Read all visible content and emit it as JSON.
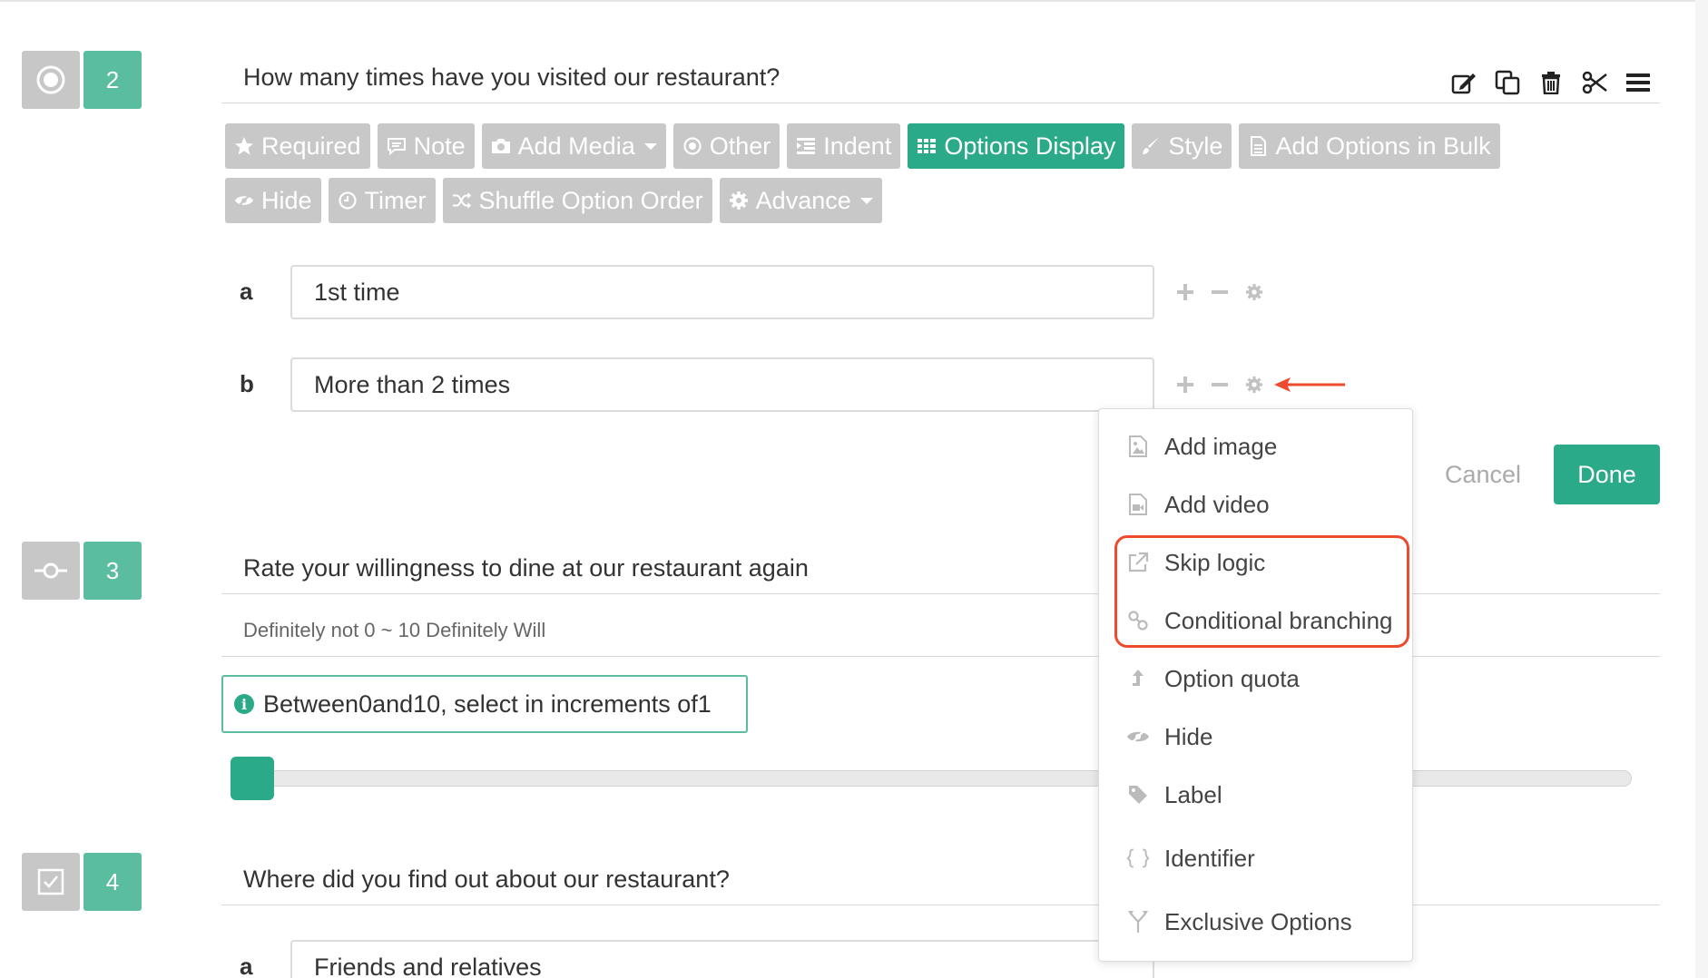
{
  "questions": [
    {
      "number": "2",
      "type_icon": "radio-icon",
      "title": "How many times have you visited our restaurant?",
      "actions": [
        "edit-icon",
        "copy-icon",
        "trash-icon",
        "scissors-icon",
        "menu-icon"
      ],
      "toolbar": {
        "row1": [
          {
            "label": "Required",
            "icon": "star-icon"
          },
          {
            "label": "Note",
            "icon": "comment-icon"
          },
          {
            "label": "Add Media",
            "icon": "camera-icon",
            "caret": true
          },
          {
            "label": "Other",
            "icon": "radio-dot-icon"
          },
          {
            "label": "Indent",
            "icon": "indent-icon"
          },
          {
            "label": "Options Display",
            "icon": "grid-icon",
            "active": true
          },
          {
            "label": "Style",
            "icon": "brush-icon"
          },
          {
            "label": "Add Options in Bulk",
            "icon": "document-icon"
          }
        ],
        "row2": [
          {
            "label": "Hide",
            "icon": "eye-slash-icon"
          },
          {
            "label": "Timer",
            "icon": "clock-icon"
          },
          {
            "label": "Shuffle Option Order",
            "icon": "shuffle-icon"
          },
          {
            "label": "Advance",
            "icon": "gear-icon",
            "caret": true
          }
        ]
      },
      "options": [
        {
          "letter": "a",
          "value": "1st time"
        },
        {
          "letter": "b",
          "value": "More than 2 times"
        }
      ],
      "cancel_label": "Cancel",
      "done_label": "Done"
    },
    {
      "number": "3",
      "type_icon": "slider-type-icon",
      "title": "Rate your willingness to dine at our restaurant again",
      "scale_label": "Definitely not 0 ~ 10 Definitely Will",
      "hint": "Between0and10, select in increments of1",
      "slider_value": 0
    },
    {
      "number": "4",
      "type_icon": "checkbox-icon",
      "title": "Where did you find out about our restaurant?",
      "options": [
        {
          "letter": "a",
          "value": "Friends and relatives"
        }
      ]
    }
  ],
  "option_menu": {
    "items": [
      {
        "label": "Add image",
        "icon": "image-icon"
      },
      {
        "label": "Add video",
        "icon": "video-icon"
      },
      {
        "label": "Skip logic",
        "icon": "external-link-icon"
      },
      {
        "label": "Conditional branching",
        "icon": "link-icon"
      },
      {
        "label": "Option quota",
        "icon": "quota-icon"
      },
      {
        "label": "Hide",
        "icon": "eye-slash-icon"
      },
      {
        "label": "Label",
        "icon": "tag-icon"
      },
      {
        "label": "Identifier",
        "icon": "braces-icon"
      },
      {
        "label": "Exclusive Options",
        "icon": "fork-icon"
      }
    ]
  },
  "colors": {
    "accent": "#2baa8a",
    "badge": "#5abd9f",
    "button_gray": "#c8c8c8",
    "highlight": "#ef4a2c"
  }
}
